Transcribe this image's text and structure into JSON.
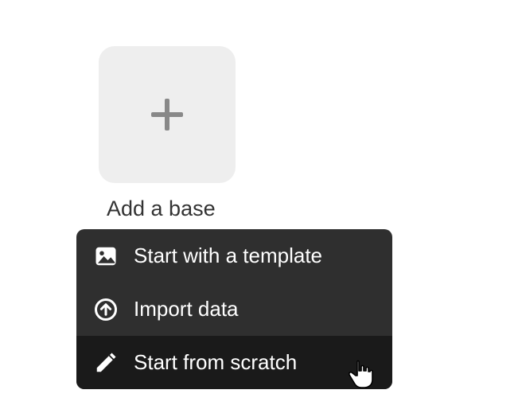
{
  "addBase": {
    "label": "Add a base"
  },
  "menu": {
    "items": [
      {
        "label": "Start with a template",
        "icon": "image-icon",
        "hovered": false
      },
      {
        "label": "Import data",
        "icon": "upload-circle-icon",
        "hovered": false
      },
      {
        "label": "Start from scratch",
        "icon": "pencil-icon",
        "hovered": true
      }
    ]
  }
}
